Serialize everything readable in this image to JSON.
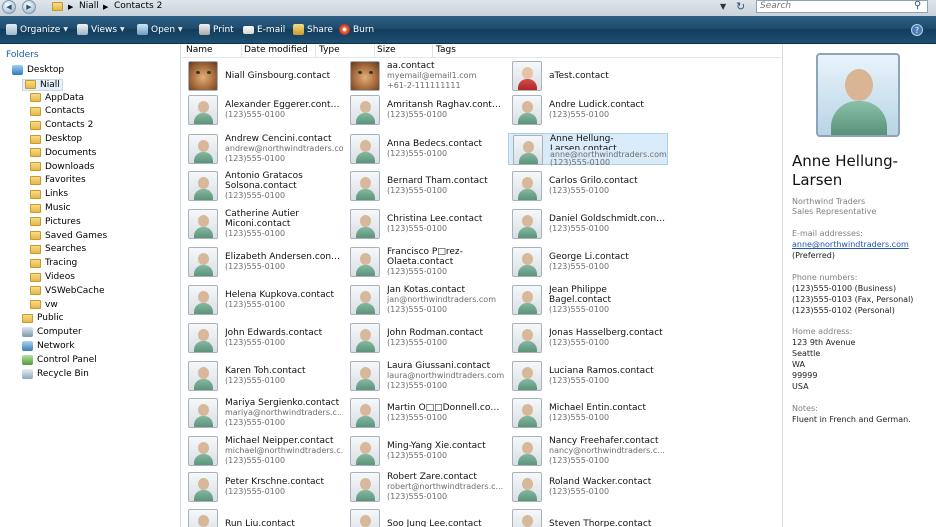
{
  "address": {
    "breadcrumb": [
      "Niall",
      "Contacts 2"
    ],
    "search_placeholder": "Search"
  },
  "toolbar": {
    "organize": "Organize",
    "views": "Views",
    "open": "Open",
    "print": "Print",
    "email": "E-mail",
    "share": "Share",
    "burn": "Burn"
  },
  "sidebar": {
    "header": "Folders",
    "items": [
      {
        "label": "Desktop",
        "icon": "desktop-icon"
      },
      {
        "label": "Niall",
        "icon": "user-folder-icon"
      },
      {
        "label": "AppData",
        "icon": "folder-icon"
      },
      {
        "label": "Contacts",
        "icon": "folder-icon"
      },
      {
        "label": "Contacts 2",
        "icon": "folder-icon"
      },
      {
        "label": "Desktop",
        "icon": "folder-icon"
      },
      {
        "label": "Documents",
        "icon": "folder-icon"
      },
      {
        "label": "Downloads",
        "icon": "folder-icon"
      },
      {
        "label": "Favorites",
        "icon": "folder-icon"
      },
      {
        "label": "Links",
        "icon": "folder-icon"
      },
      {
        "label": "Music",
        "icon": "folder-icon"
      },
      {
        "label": "Pictures",
        "icon": "folder-icon"
      },
      {
        "label": "Saved Games",
        "icon": "folder-icon"
      },
      {
        "label": "Searches",
        "icon": "folder-icon"
      },
      {
        "label": "Tracing",
        "icon": "folder-icon"
      },
      {
        "label": "Videos",
        "icon": "folder-icon"
      },
      {
        "label": "VSWebCache",
        "icon": "folder-icon"
      },
      {
        "label": "vw",
        "icon": "folder-icon"
      },
      {
        "label": "Public",
        "icon": "folder-icon"
      },
      {
        "label": "Computer",
        "icon": "computer-icon"
      },
      {
        "label": "Network",
        "icon": "network-icon"
      },
      {
        "label": "Control Panel",
        "icon": "control-panel-icon"
      },
      {
        "label": "Recycle Bin",
        "icon": "recycle-bin-icon"
      }
    ]
  },
  "columns": [
    "Name",
    "Date modified",
    "Type",
    "Size",
    "Tags"
  ],
  "contacts": [
    {
      "name": "Niall Ginsbourg.contact",
      "lines": [],
      "avatar": "cat"
    },
    {
      "name": "aa.contact",
      "lines": [
        "myemail@email1.com",
        "+61-2-111111111"
      ],
      "avatar": "cat"
    },
    {
      "name": "aTest.contact",
      "lines": [],
      "avatar": "red"
    },
    {
      "name": "Alexander Eggerer.contact",
      "lines": [
        "(123)555-0100"
      ],
      "avatar": "default"
    },
    {
      "name": "Amritansh Raghav.contact",
      "lines": [
        "(123)555-0100"
      ],
      "avatar": "default"
    },
    {
      "name": "Andre Ludick.contact",
      "lines": [
        "(123)555-0100"
      ],
      "avatar": "default"
    },
    {
      "name": "Andrew Cencini.contact",
      "lines": [
        "andrew@northwindtraders.com",
        "(123)555-0100"
      ],
      "avatar": "default"
    },
    {
      "name": "Anna Bedecs.contact",
      "lines": [
        "(123)555-0100"
      ],
      "avatar": "default"
    },
    {
      "name": "Anne Hellung-Larsen.contact",
      "lines": [
        "anne@northwindtraders.com",
        "(123)555-0100"
      ],
      "avatar": "default",
      "selected": true
    },
    {
      "name": "Antonio Gratacos Solsona.contact",
      "lines": [
        "(123)555-0100"
      ],
      "avatar": "default"
    },
    {
      "name": "Bernard Tham.contact",
      "lines": [
        "(123)555-0100"
      ],
      "avatar": "default"
    },
    {
      "name": "Carlos Grilo.contact",
      "lines": [
        "(123)555-0100"
      ],
      "avatar": "default"
    },
    {
      "name": "Catherine Autier Miconi.contact",
      "lines": [
        "(123)555-0100"
      ],
      "avatar": "default"
    },
    {
      "name": "Christina Lee.contact",
      "lines": [
        "(123)555-0100"
      ],
      "avatar": "default"
    },
    {
      "name": "Daniel Goldschmidt.contact",
      "lines": [
        "(123)555-0100"
      ],
      "avatar": "default"
    },
    {
      "name": "Elizabeth Andersen.contact",
      "lines": [
        "(123)555-0100"
      ],
      "avatar": "default"
    },
    {
      "name": "Francisco P□rez-Olaeta.contact",
      "lines": [
        "(123)555-0100"
      ],
      "avatar": "default"
    },
    {
      "name": "George Li.contact",
      "lines": [
        "(123)555-0100"
      ],
      "avatar": "default"
    },
    {
      "name": "Helena Kupkova.contact",
      "lines": [
        "(123)555-0100"
      ],
      "avatar": "default"
    },
    {
      "name": "Jan Kotas.contact",
      "lines": [
        "jan@northwindtraders.com",
        "(123)555-0100"
      ],
      "avatar": "default"
    },
    {
      "name": "Jean Philippe Bagel.contact",
      "lines": [
        "(123)555-0100"
      ],
      "avatar": "default"
    },
    {
      "name": "John Edwards.contact",
      "lines": [
        "(123)555-0100"
      ],
      "avatar": "default"
    },
    {
      "name": "John Rodman.contact",
      "lines": [
        "(123)555-0100"
      ],
      "avatar": "default"
    },
    {
      "name": "Jonas Hasselberg.contact",
      "lines": [
        "(123)555-0100"
      ],
      "avatar": "default"
    },
    {
      "name": "Karen Toh.contact",
      "lines": [
        "(123)555-0100"
      ],
      "avatar": "default"
    },
    {
      "name": "Laura Giussani.contact",
      "lines": [
        "laura@northwindtraders.com",
        "(123)555-0100"
      ],
      "avatar": "default"
    },
    {
      "name": "Luciana Ramos.contact",
      "lines": [
        "(123)555-0100"
      ],
      "avatar": "default"
    },
    {
      "name": "Mariya Sergienko.contact",
      "lines": [
        "mariya@northwindtraders.c...",
        "(123)555-0100"
      ],
      "avatar": "default"
    },
    {
      "name": "Martin O□□Donnell.contact",
      "lines": [
        "(123)555-0100"
      ],
      "avatar": "default"
    },
    {
      "name": "Michael Entin.contact",
      "lines": [
        "(123)555-0100"
      ],
      "avatar": "default"
    },
    {
      "name": "Michael Neipper.contact",
      "lines": [
        "michael@northwindtraders.c...",
        "(123)555-0100"
      ],
      "avatar": "default"
    },
    {
      "name": "Ming-Yang Xie.contact",
      "lines": [
        "(123)555-0100"
      ],
      "avatar": "default"
    },
    {
      "name": "Nancy Freehafer.contact",
      "lines": [
        "nancy@northwindtraders.c...",
        "(123)555-0100"
      ],
      "avatar": "default"
    },
    {
      "name": "Peter Krschne.contact",
      "lines": [
        "(123)555-0100"
      ],
      "avatar": "default"
    },
    {
      "name": "Robert Zare.contact",
      "lines": [
        "robert@northwindtraders.c...",
        "(123)555-0100"
      ],
      "avatar": "default"
    },
    {
      "name": "Roland Wacker.contact",
      "lines": [
        "(123)555-0100"
      ],
      "avatar": "default"
    },
    {
      "name": "Run Liu.contact",
      "lines": [],
      "avatar": "default"
    },
    {
      "name": "Soo Jung Lee.contact",
      "lines": [],
      "avatar": "default"
    },
    {
      "name": "Steven Thorpe.contact",
      "lines": [],
      "avatar": "default"
    }
  ],
  "preview": {
    "name": "Anne Hellung-Larsen",
    "company": "Northwind Traders",
    "title": "Sales Representative",
    "email_label": "E-mail addresses:",
    "email": "anne@northwindtraders.com",
    "email_note": "(Preferred)",
    "phone_label": "Phone numbers:",
    "phones": [
      "(123)555-0100 (Business)",
      "(123)555-0103 (Fax, Personal)",
      "(123)555-0102 (Personal)"
    ],
    "address_label": "Home address:",
    "address": [
      "123 9th Avenue",
      "Seattle",
      "WA",
      "99999",
      "USA"
    ],
    "notes_label": "Notes:",
    "notes": "Fluent in French and German."
  }
}
